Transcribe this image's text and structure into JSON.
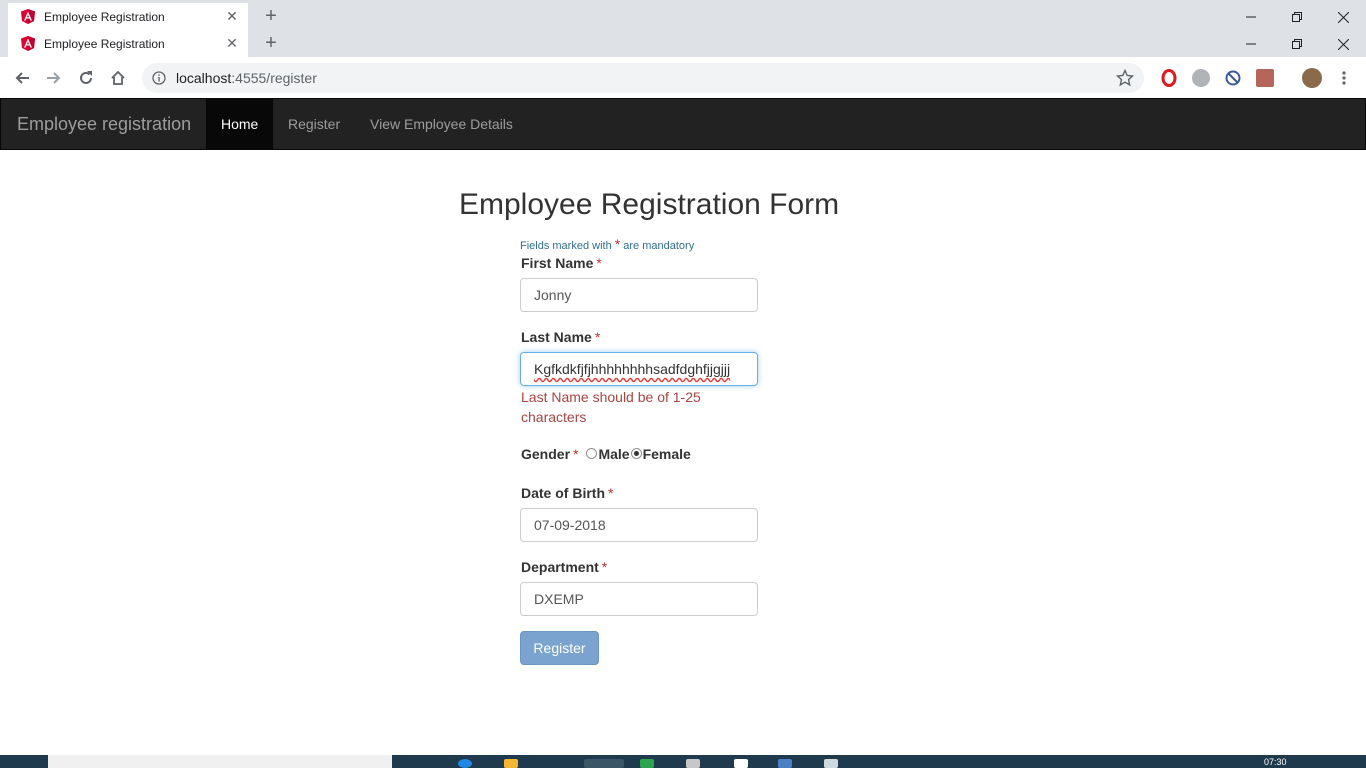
{
  "browser": {
    "tabs": [
      {
        "title": "Employee Registration"
      },
      {
        "title": "Employee Registration"
      }
    ],
    "new_tab_label": "+",
    "url_host": "localhost",
    "url_path": ":4555/register"
  },
  "navbar": {
    "brand": "Employee registration",
    "links": [
      {
        "label": "Home",
        "active": true
      },
      {
        "label": "Register",
        "active": false
      },
      {
        "label": "View Employee Details",
        "active": false
      }
    ]
  },
  "form": {
    "title": "Employee Registration Form",
    "note_prefix": "Fields marked with",
    "note_star": "*",
    "note_suffix": "are mandatory",
    "required_marker": "*",
    "first_name": {
      "label": "First Name",
      "value": "Jonny"
    },
    "last_name": {
      "label": "Last Name",
      "value": "Kgfkdkfjfjhhhhhhhhsadfdghfjjgjjj",
      "error": "Last Name should be of 1-25 characters"
    },
    "gender": {
      "label": "Gender",
      "options": [
        {
          "label": "Male",
          "checked": false
        },
        {
          "label": "Female",
          "checked": true
        }
      ]
    },
    "dob": {
      "label": "Date of Birth",
      "value": "07-09-2018"
    },
    "department": {
      "label": "Department",
      "value": "DXEMP"
    },
    "submit_label": "Register"
  },
  "taskbar": {
    "time": "07:30"
  },
  "colors": {
    "navbar_bg": "#222222",
    "active_link_bg": "#080808",
    "required": "#c9302c",
    "error": "#a94442",
    "button_bg": "#7aa4cf",
    "angular_red": "#dd0031"
  }
}
